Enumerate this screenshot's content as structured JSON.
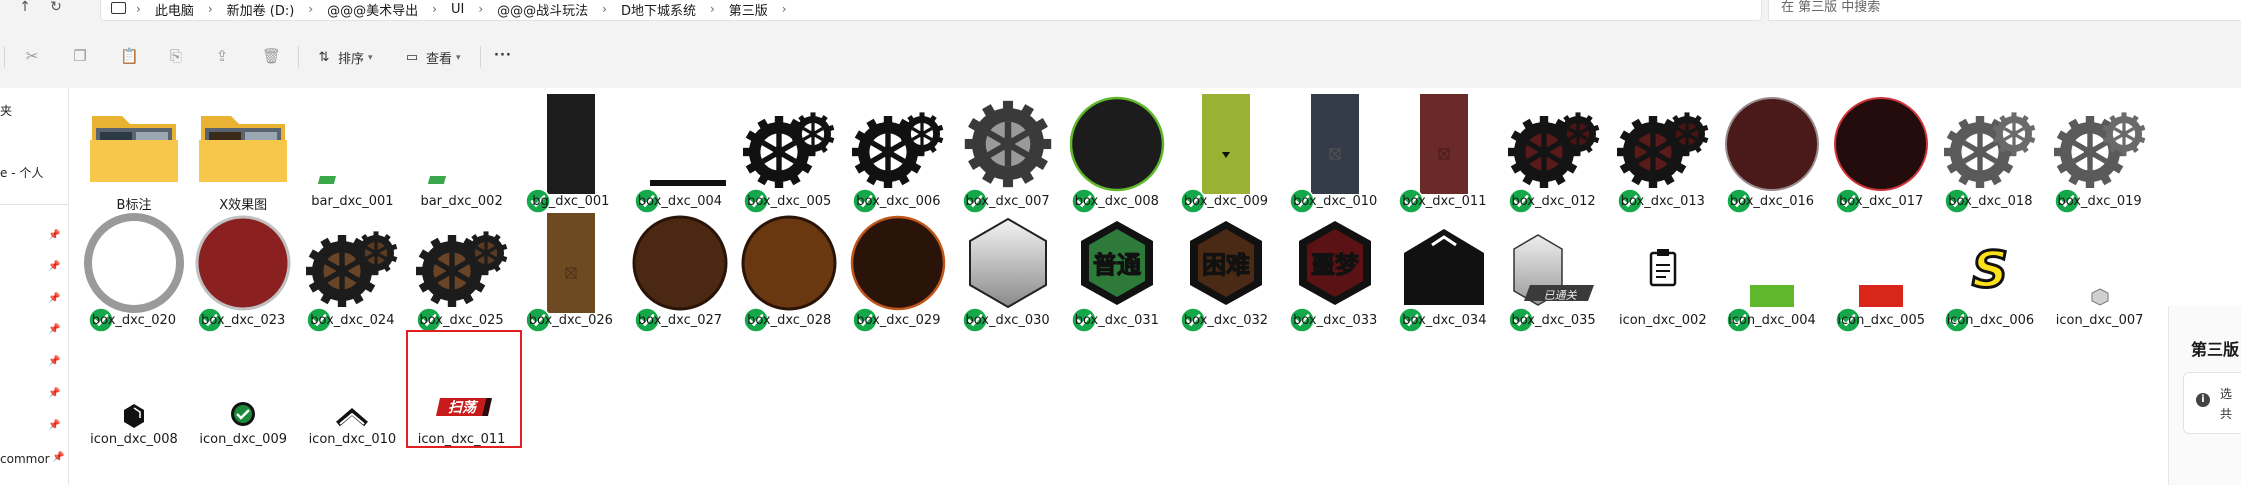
{
  "nav": {
    "up": "↑",
    "refresh": "↻"
  },
  "breadcrumb": [
    "此电脑",
    "新加卷 (D:)",
    "@@@美术导出",
    "UI",
    "@@@战斗玩法",
    "D地下城系统",
    "第三版"
  ],
  "search": {
    "placeholder": "在 第三版 中搜索"
  },
  "toolbar": {
    "sort_label": "排序",
    "view_label": "查看",
    "more": "···"
  },
  "sidebar": {
    "item_a": "夹",
    "item_b": "e - 个人",
    "item_c": "commor"
  },
  "details": {
    "title": "第三版",
    "line1": "选",
    "line2": "共",
    "info": "i"
  },
  "files": [
    {
      "name": "B标注",
      "thumb": "folder-b"
    },
    {
      "name": "X效果图",
      "thumb": "folder-x"
    },
    {
      "name": "bar_dxc_001",
      "thumb": "bar-small"
    },
    {
      "name": "bar_dxc_002",
      "thumb": "bar-small"
    },
    {
      "name": "bg_dxc_001",
      "thumb": "bg-dark"
    },
    {
      "name": "box_dxc_004",
      "thumb": "bar-line"
    },
    {
      "name": "box_dxc_005",
      "thumb": "gears-black"
    },
    {
      "name": "box_dxc_006",
      "thumb": "gears-black"
    },
    {
      "name": "box_dxc_007",
      "thumb": "gear-gray"
    },
    {
      "name": "box_dxc_008",
      "thumb": "circle-dark-green"
    },
    {
      "name": "box_dxc_009",
      "thumb": "rect-olive"
    },
    {
      "name": "box_dxc_010",
      "thumb": "rect-slate"
    },
    {
      "name": "box_dxc_011",
      "thumb": "rect-maroon"
    },
    {
      "name": "box_dxc_012",
      "thumb": "gears-red"
    },
    {
      "name": "box_dxc_013",
      "thumb": "gears-red"
    },
    {
      "name": "box_dxc_016",
      "thumb": "circle-maroon"
    },
    {
      "name": "box_dxc_017",
      "thumb": "circle-darkred"
    },
    {
      "name": "box_dxc_018",
      "thumb": "gears-gray"
    },
    {
      "name": "box_dxc_019",
      "thumb": "gears-gray"
    },
    {
      "name": "box_dxc_020",
      "thumb": "circle-silver"
    },
    {
      "name": "box_dxc_023",
      "thumb": "circle-red"
    },
    {
      "name": "box_dxc_024",
      "thumb": "gears-bronze"
    },
    {
      "name": "box_dxc_025",
      "thumb": "gears-bronze"
    },
    {
      "name": "box_dxc_026",
      "thumb": "rect-brown"
    },
    {
      "name": "box_dxc_027",
      "thumb": "circle-brown"
    },
    {
      "name": "box_dxc_028",
      "thumb": "circle-orange"
    },
    {
      "name": "box_dxc_029",
      "thumb": "circle-darkbrown"
    },
    {
      "name": "box_dxc_030",
      "thumb": "hex-gray"
    },
    {
      "name": "box_dxc_031",
      "thumb": "badge-green",
      "text": "普通"
    },
    {
      "name": "box_dxc_032",
      "thumb": "badge-orange",
      "text": "困难"
    },
    {
      "name": "box_dxc_033",
      "thumb": "badge-red",
      "text": "噩梦"
    },
    {
      "name": "box_dxc_034",
      "thumb": "house-black"
    },
    {
      "name": "box_dxc_035",
      "thumb": "hex-done",
      "text": "已通关"
    },
    {
      "name": "icon_dxc_002",
      "thumb": "clipboard"
    },
    {
      "name": "icon_dxc_004",
      "thumb": "small-green"
    },
    {
      "name": "icon_dxc_005",
      "thumb": "small-red"
    },
    {
      "name": "icon_dxc_006",
      "thumb": "s-letter",
      "text": "S"
    },
    {
      "name": "icon_dxc_007",
      "thumb": "tiny-gray"
    },
    {
      "name": "icon_dxc_008",
      "thumb": "hex-small"
    },
    {
      "name": "icon_dxc_009",
      "thumb": "check-circle"
    },
    {
      "name": "icon_dxc_010",
      "thumb": "chevron-up"
    },
    {
      "name": "icon_dxc_011",
      "thumb": "sweep-tag",
      "text": "扫荡",
      "selected": true
    }
  ],
  "colors": {
    "accent_check": "#14a84a",
    "selection": "#e02020",
    "folder": "#f6c74a"
  }
}
